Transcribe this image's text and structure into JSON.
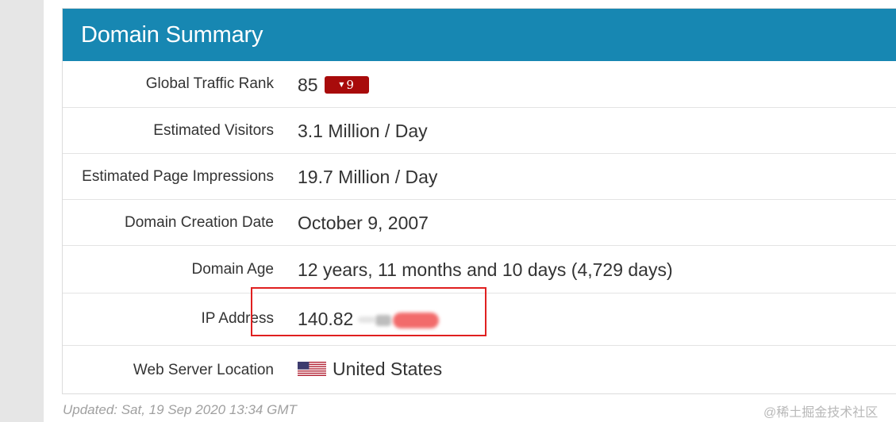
{
  "panel": {
    "title": "Domain Summary"
  },
  "rows": {
    "global_traffic_rank": {
      "label": "Global Traffic Rank",
      "value": "85",
      "badge_arrow": "▼",
      "badge_value": "9"
    },
    "estimated_visitors": {
      "label": "Estimated Visitors",
      "value": "3.1 Million / Day"
    },
    "estimated_page_impressions": {
      "label": "Estimated Page Impressions",
      "value": "19.7 Million / Day"
    },
    "domain_creation_date": {
      "label": "Domain Creation Date",
      "value": "October 9, 2007"
    },
    "domain_age": {
      "label": "Domain Age",
      "value": "12 years, 11 months and 10 days (4,729 days)"
    },
    "ip_address": {
      "label": "IP Address",
      "value": "140.82"
    },
    "web_server_location": {
      "label": "Web Server Location",
      "value": "United States",
      "flag_icon": "us-flag-icon"
    }
  },
  "footer": {
    "updated": "Updated: Sat, 19 Sep 2020 13:34 GMT",
    "watermark": "@稀土掘金技术社区"
  },
  "colors": {
    "header_bg": "#1787b2",
    "badge_bg": "#a80b0b",
    "highlight_border": "#e02020"
  }
}
